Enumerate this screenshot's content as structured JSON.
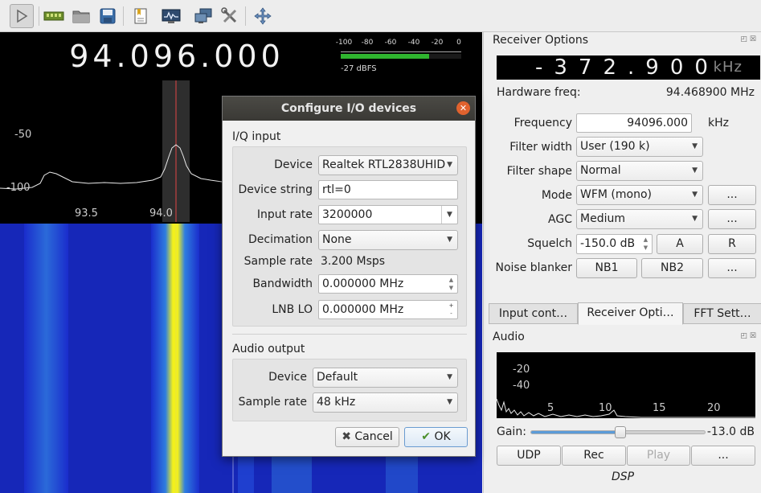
{
  "toolbar": {
    "buttons": [
      {
        "name": "play-icon"
      },
      {
        "name": "hardware-icon"
      },
      {
        "name": "open-folder-icon"
      },
      {
        "name": "save-icon"
      },
      {
        "name": "bookmark-icon"
      },
      {
        "name": "io-devices-icon"
      },
      {
        "name": "remote-control-icon"
      },
      {
        "name": "tools-icon"
      },
      {
        "name": "fullscreen-icon"
      }
    ]
  },
  "spectrum": {
    "frequency": "94.096.000",
    "smeter_ticks": [
      "-100",
      "-80",
      "-60",
      "-40",
      "-20",
      "0"
    ],
    "smeter_level_dbfs": -27,
    "smeter_readout": "-27 dBFS",
    "y_labels": [
      "-50",
      "-100"
    ],
    "x_labels": [
      "93.5",
      "94.0"
    ]
  },
  "dialog": {
    "title": "Configure I/O devices",
    "iq_input": {
      "title": "I/Q input",
      "device_label": "Device",
      "device_value": "Realtek RTL2838UHID",
      "device_string_label": "Device string",
      "device_string_value": "rtl=0",
      "input_rate_label": "Input rate",
      "input_rate_value": "3200000",
      "decimation_label": "Decimation",
      "decimation_value": "None",
      "sample_rate_label": "Sample rate",
      "sample_rate_value": "3.200 Msps",
      "bandwidth_label": "Bandwidth",
      "bandwidth_value": "0.000000 MHz",
      "lnb_lo_label": "LNB LO",
      "lnb_lo_value": "0.000000 MHz"
    },
    "audio_output": {
      "title": "Audio output",
      "device_label": "Device",
      "device_value": "Default",
      "sample_rate_label": "Sample rate",
      "sample_rate_value": "48 kHz"
    },
    "cancel_label": "Cancel",
    "ok_label": "OK"
  },
  "receiver": {
    "title": "Receiver Options",
    "offset_display": "-372.900",
    "offset_unit": "kHz",
    "hw_freq_label": "Hardware freq:",
    "hw_freq_value": "94.468900 MHz",
    "frequency_label": "Frequency",
    "frequency_value": "94096.000",
    "frequency_unit": "kHz",
    "filter_width_label": "Filter width",
    "filter_width_value": "User (190 k)",
    "filter_shape_label": "Filter shape",
    "filter_shape_value": "Normal",
    "mode_label": "Mode",
    "mode_value": "WFM (mono)",
    "agc_label": "AGC",
    "agc_value": "Medium",
    "squelch_label": "Squelch",
    "squelch_value": "-150.0 dB",
    "squelch_a": "A",
    "squelch_r": "R",
    "noise_blanker_label": "Noise blanker",
    "nb1": "NB1",
    "nb2": "NB2",
    "more": "...",
    "tabs": [
      "Input cont…",
      "Receiver Opti…",
      "FFT Sett…"
    ]
  },
  "audio": {
    "title": "Audio",
    "y_labels": [
      "-20",
      "-40"
    ],
    "x_labels": [
      "5",
      "10",
      "15",
      "20"
    ],
    "gain_label": "Gain:",
    "gain_value": "-13.0 dB",
    "gain_fraction": 0.51,
    "udp": "UDP",
    "rec": "Rec",
    "play": "Play",
    "more": "...",
    "dsp": "DSP"
  }
}
